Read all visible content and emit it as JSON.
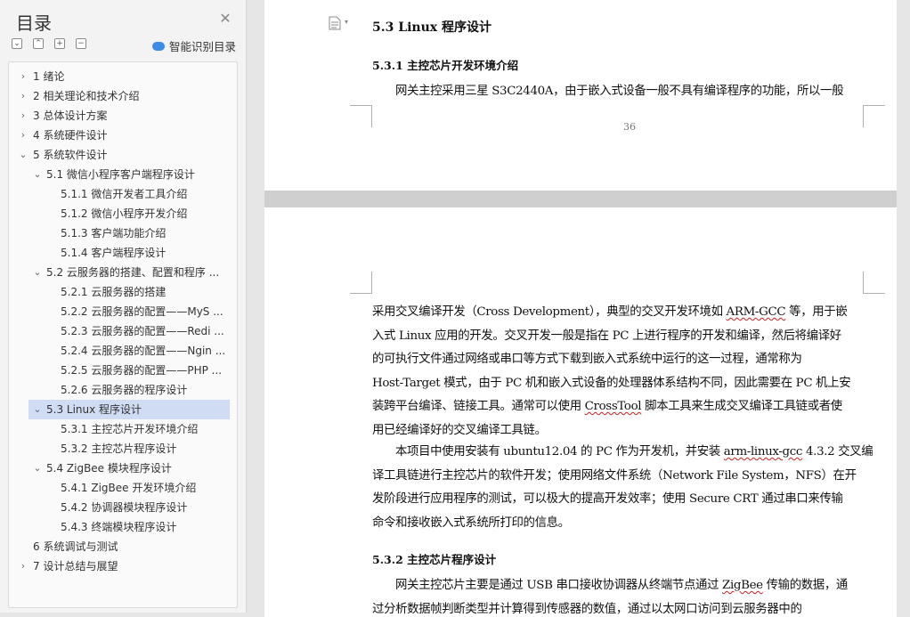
{
  "toc_panel": {
    "title": "目录",
    "close_symbol": "✕",
    "toolbar": {
      "collapse_all": "⌄",
      "expand_all": "⌃",
      "add": "+",
      "remove": "−",
      "smart_toc_label": "智能识别目录"
    },
    "items": [
      {
        "text": "1  绪论",
        "level": 1,
        "expand": "collapsed"
      },
      {
        "text": "2  相关理论和技术介绍",
        "level": 1,
        "expand": "collapsed"
      },
      {
        "text": "3  总体设计方案",
        "level": 1,
        "expand": "collapsed"
      },
      {
        "text": "4  系统硬件设计",
        "level": 1,
        "expand": "collapsed"
      },
      {
        "text": "5  系统软件设计",
        "level": 1,
        "expand": "expanded"
      },
      {
        "text": "5.1  微信小程序客户端程序设计",
        "level": 2,
        "expand": "expanded"
      },
      {
        "text": "5.1.1  微信开发者工具介绍",
        "level": 3,
        "expand": "none"
      },
      {
        "text": "5.1.2  微信小程序开发介绍",
        "level": 3,
        "expand": "none"
      },
      {
        "text": "5.1.3  客户端功能介绍",
        "level": 3,
        "expand": "none"
      },
      {
        "text": "5.1.4  客户端程序设计",
        "level": 3,
        "expand": "none"
      },
      {
        "text": "5.2  云服务器的搭建、配置和程序 ...",
        "level": 2,
        "expand": "expanded"
      },
      {
        "text": "5.2.1  云服务器的搭建",
        "level": 3,
        "expand": "none"
      },
      {
        "text": "5.2.2  云服务器的配置——MyS ...",
        "level": 3,
        "expand": "none"
      },
      {
        "text": "5.2.3  云服务器的配置——Redi ...",
        "level": 3,
        "expand": "none"
      },
      {
        "text": "5.2.4  云服务器的配置——Ngin ...",
        "level": 3,
        "expand": "none"
      },
      {
        "text": "5.2.5  云服务器的配置——PHP ...",
        "level": 3,
        "expand": "none"
      },
      {
        "text": "5.2.6  云服务器的程序设计",
        "level": 3,
        "expand": "none"
      },
      {
        "text": "5.3 Linux 程序设计",
        "level": 2,
        "expand": "expanded",
        "selected": true
      },
      {
        "text": "5.3.1  主控芯片开发环境介绍",
        "level": 3,
        "expand": "none"
      },
      {
        "text": "5.3.2  主控芯片程序设计",
        "level": 3,
        "expand": "none"
      },
      {
        "text": "5.4 ZigBee 模块程序设计",
        "level": 2,
        "expand": "expanded"
      },
      {
        "text": "5.4.1 ZigBee 开发环境介绍",
        "level": 3,
        "expand": "none"
      },
      {
        "text": "5.4.2  协调器模块程序设计",
        "level": 3,
        "expand": "none"
      },
      {
        "text": "5.4.3  终端模块程序设计",
        "level": 3,
        "expand": "none"
      },
      {
        "text": "6  系统调试与测试",
        "level": 1,
        "expand": "none"
      },
      {
        "text": "7  设计总结与展望",
        "level": 1,
        "expand": "collapsed"
      }
    ]
  },
  "document": {
    "page_top": {
      "heading_2": "5.3 Linux 程序设计",
      "heading_3": "5.3.1  主控芯片开发环境介绍",
      "para_line": "网关主控采用三星 S3C2440A，由于嵌入式设备一般不具有编译程序的功能，所以一般",
      "page_number": "36"
    },
    "page_bottom": {
      "p1_lines": [
        "采用交叉编译开发（Cross Development），典型的交叉开发环境如 ARM-GCC 等，用于嵌",
        "入式 Linux 应用的开发。交叉开发一般是指在 PC 上进行程序的开发和编译，然后将编译好",
        "的可执行文件通过网络或串口等方式下载到嵌入式系统中运行的这一过程，通常称为",
        "Host-Target 模式，由于 PC 机和嵌入式设备的处理器体系结构不同，因此需要在 PC 机上安",
        "装跨平台编译、链接工具。通常可以使用 CrossTool 脚本工具来生成交叉编译工具链或者使",
        "用已经编译好的交叉编译工具链。"
      ],
      "p2_lines": [
        "本项目中使用安装有 ubuntu12.04 的 PC 作为开发机，并安装 arm-linux-gcc 4.3.2 交叉编",
        "译工具链进行主控芯片的软件开发；使用网络文件系统（Network File System，NFS）在开",
        "发阶段进行应用程序的测试，可以极大的提高开发效率；使用 Secure CRT 通过串口来传输",
        "命令和接收嵌入式系统所打印的信息。"
      ],
      "heading_3b": "5.3.2  主控芯片程序设计",
      "p3_lines": [
        "网关主控芯片主要是通过 USB 串口接收协调器从终端节点通过 ZigBee 传输的数据，通",
        "过分析数据帧判断类型并计算得到传感器的数值，通过以太网口访问到云服务器中的"
      ]
    }
  }
}
